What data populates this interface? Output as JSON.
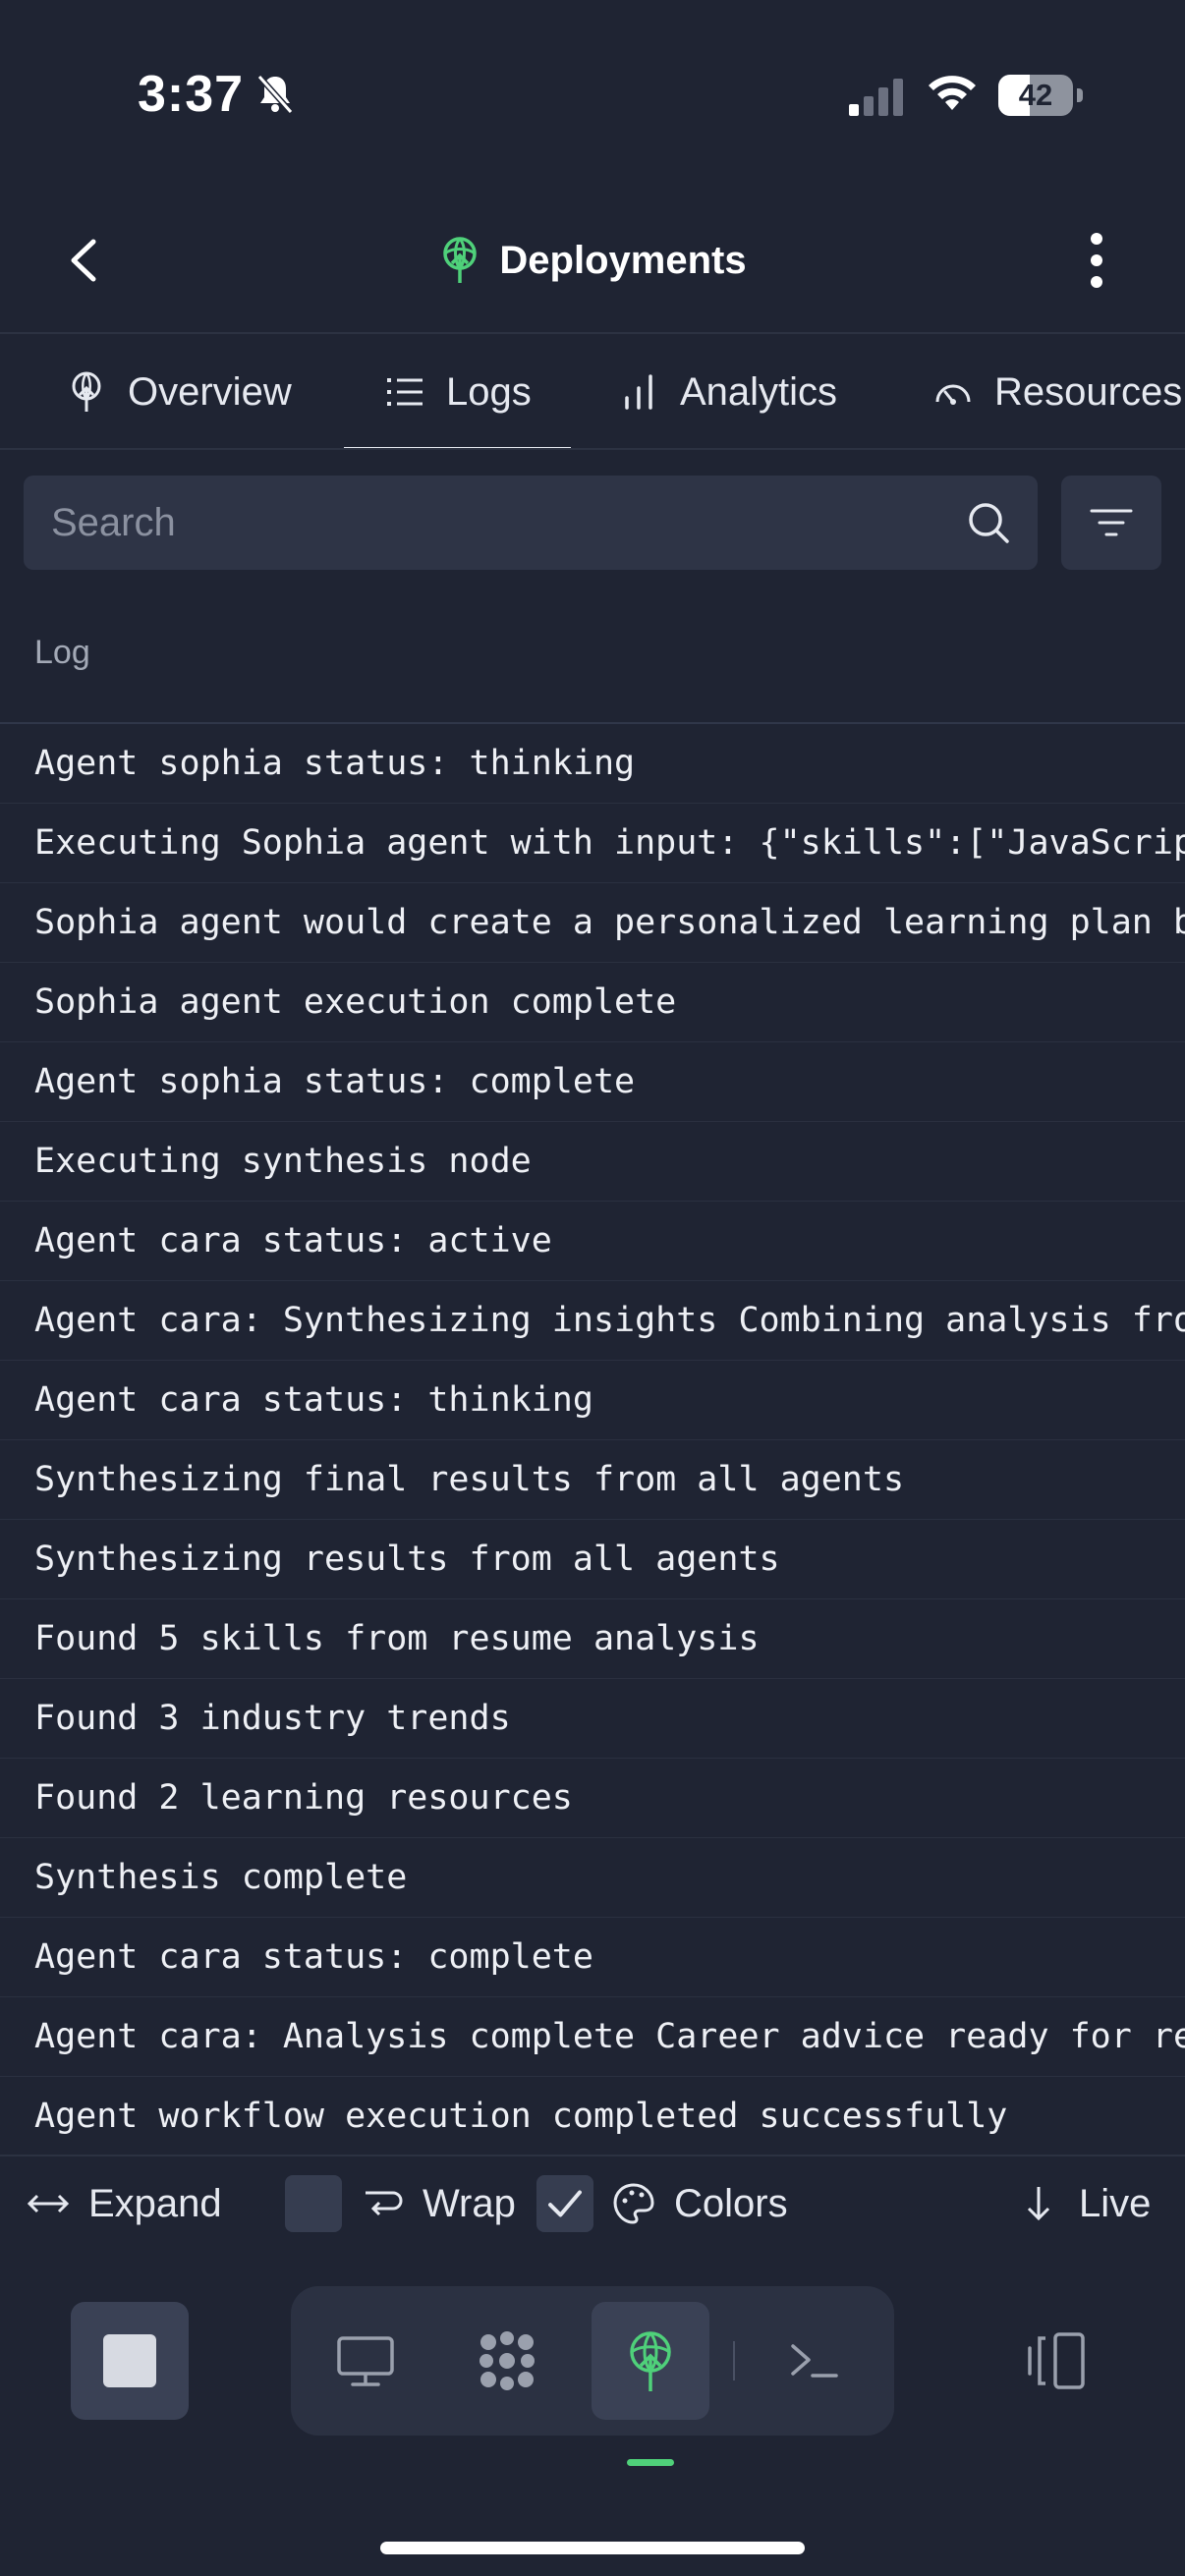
{
  "status_bar": {
    "time": "3:37",
    "battery_level": "42"
  },
  "header": {
    "title": "Deployments"
  },
  "tabs": [
    {
      "label": "Overview",
      "icon": "deploy-icon",
      "active": false
    },
    {
      "label": "Logs",
      "icon": "list-icon",
      "active": true
    },
    {
      "label": "Analytics",
      "icon": "bar-chart-icon",
      "active": false
    },
    {
      "label": "Resources",
      "icon": "gauge-icon",
      "active": false
    }
  ],
  "search": {
    "placeholder": "Search",
    "value": ""
  },
  "log_table": {
    "column_header": "Log",
    "rows": [
      "Agent sophia status: thinking",
      "Executing Sophia agent with input: {\"skills\":[\"JavaScript\",\"React\",\"Node.js\"]}",
      "Sophia agent would create a personalized learning plan based on skills",
      "Sophia agent execution complete",
      "Agent sophia status: complete",
      "Executing synthesis node",
      "Agent cara status: active",
      "Agent cara: Synthesizing insights Combining analysis from all agents",
      "Agent cara status: thinking",
      "Synthesizing final results from all agents",
      "Synthesizing results from all agents",
      "Found 5 skills from resume analysis",
      "Found 3 industry trends",
      "Found 2 learning resources",
      "Synthesis complete",
      "Agent cara status: complete",
      "Agent cara: Analysis complete Career advice ready for review",
      "Agent workflow execution completed successfully"
    ]
  },
  "toolbar": {
    "expand_label": "Expand",
    "wrap_label": "Wrap",
    "wrap_checked": false,
    "colors_label": "Colors",
    "colors_checked": true,
    "live_label": "Live"
  },
  "dock": {
    "items": [
      "stop",
      "desktop",
      "apps",
      "deployments",
      "terminal",
      "panel"
    ],
    "active": "deployments"
  },
  "colors": {
    "background": "#1f2433",
    "accent_green": "#4fd17a",
    "surface": "#2e3446"
  }
}
